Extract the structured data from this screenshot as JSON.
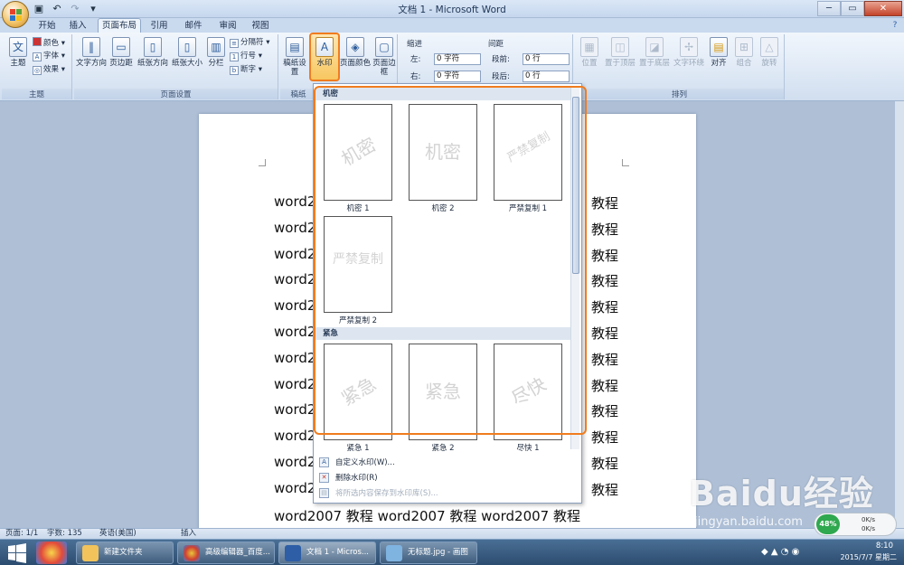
{
  "window": {
    "title": "文档 1 - Microsoft Word",
    "controls": [
      "─",
      "▭",
      "✕"
    ]
  },
  "tabs": [
    "开始",
    "插入",
    "页面布局",
    "引用",
    "邮件",
    "审阅",
    "视图"
  ],
  "active_tab": "页面布局",
  "ribbon": {
    "theme_group": {
      "label": "主题",
      "theme_btn": "主题",
      "colors": "颜色",
      "fonts": "字体",
      "effects": "效果"
    },
    "page_setup_group": {
      "label": "页面设置",
      "text_direction": "文字方向",
      "margins": "页边距",
      "orientation": "纸张方向",
      "size": "纸张大小",
      "columns": "分栏",
      "breaks": "分隔符",
      "line_numbers": "行号",
      "hyphenation": "断字"
    },
    "background_group": {
      "label": "稿纸",
      "draft_paper": "稿纸设置",
      "watermark": "水印",
      "page_color": "页面颜色",
      "page_borders": "页面边框"
    },
    "paragraph_group": {
      "indent_title": "缩进",
      "spacing_title": "间距",
      "left_label": "左:",
      "right_label": "右:",
      "before_label": "段前:",
      "after_label": "段后:",
      "left_val": "0 字符",
      "right_val": "0 字符",
      "before_val": "0 行",
      "after_val": "0 行"
    },
    "arrange_group": {
      "label": "排列",
      "position": "位置",
      "bring_front": "置于顶层",
      "send_back": "置于底层",
      "text_wrap": "文字环绕",
      "align": "对齐",
      "group": "组合",
      "rotate": "旋转"
    }
  },
  "document": {
    "lines": [
      {
        "l": "word2",
        "r": "教程"
      },
      {
        "l": "word2",
        "r": "教程"
      },
      {
        "l": "word2",
        "r": "教程"
      },
      {
        "l": "word2",
        "r": "教程"
      },
      {
        "l": "word2",
        "r": "教程"
      },
      {
        "l": "word2",
        "r": "教程"
      },
      {
        "l": "word2",
        "r": "教程"
      },
      {
        "l": "word2",
        "r": "教程"
      },
      {
        "l": "word2",
        "r": "教程"
      },
      {
        "l": "word2",
        "r": "教程"
      },
      {
        "l": "word2",
        "r": "教程"
      },
      {
        "l": "word2",
        "r": "教程"
      }
    ],
    "full_line": "word2007 教程 word2007 教程 word2007 教程"
  },
  "watermark_gallery": {
    "section1": "机密",
    "section2": "紧急",
    "items": [
      {
        "label": "机密 1",
        "text": "机密"
      },
      {
        "label": "机密 2",
        "text": "机密"
      },
      {
        "label": "严禁复制 1",
        "text": "严禁复制"
      },
      {
        "label": "严禁复制 2",
        "text": "严禁复制"
      },
      {
        "label": "紧急 1",
        "text": "紧急"
      },
      {
        "label": "紧急 2",
        "text": "紧急"
      },
      {
        "label": "尽快 1",
        "text": "尽快"
      }
    ],
    "menu": [
      "自定义水印(W)...",
      "删除水印(R)",
      "将所选内容保存到水印库(S)..."
    ]
  },
  "statusbar": {
    "page": "页面: 1/1",
    "words": "字数: 135",
    "lang": "英语(美国)",
    "mode": "插入"
  },
  "taskbar": {
    "items": [
      "新建文件夹",
      "高级编辑器_百度...",
      "文档 1 - Micros...",
      "无标题.jpg - 画图"
    ],
    "time": "8:10",
    "date": "2015/7/7 星期二",
    "battery": "48%",
    "up": "0K/s",
    "down": "0K/s"
  },
  "overlay": {
    "brand": "Baidu经验",
    "url": "jingyan.baidu.com"
  },
  "colors": {
    "highlight": "#f07c1e",
    "ribbon": "#dbe6f4",
    "taskbar": "#2c4c6f"
  }
}
